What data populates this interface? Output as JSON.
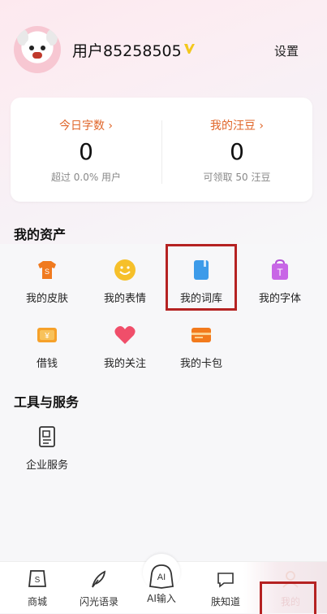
{
  "header": {
    "username": "用户85258505",
    "settings_label": "设置"
  },
  "stats": {
    "left": {
      "title": "今日字数 ›",
      "value": "0",
      "sub": "超过 0.0% 用户"
    },
    "right": {
      "title": "我的汪豆 ›",
      "value": "0",
      "sub": "可领取 50 汪豆"
    }
  },
  "assets": {
    "title": "我的资产",
    "items": [
      {
        "label": "我的皮肤",
        "icon": "shirt-icon"
      },
      {
        "label": "我的表情",
        "icon": "smile-icon"
      },
      {
        "label": "我的词库",
        "icon": "book-icon"
      },
      {
        "label": "我的字体",
        "icon": "font-bag-icon"
      },
      {
        "label": "借钱",
        "icon": "yen-icon"
      },
      {
        "label": "我的关注",
        "icon": "heart-icon"
      },
      {
        "label": "我的卡包",
        "icon": "wallet-icon"
      }
    ]
  },
  "tools": {
    "title": "工具与服务",
    "items": [
      {
        "label": "企业服务",
        "icon": "document-icon"
      }
    ]
  },
  "nav": {
    "items": [
      {
        "label": "商城",
        "icon": "store-icon"
      },
      {
        "label": "闪光语录",
        "icon": "feather-icon"
      },
      {
        "label": "AI输入",
        "icon": "ai-icon"
      },
      {
        "label": "肤知道",
        "icon": "chat-icon"
      },
      {
        "label": "我的",
        "icon": "profile-icon"
      }
    ]
  },
  "colors": {
    "accent_orange": "#e0662a",
    "highlight_red": "#b52222"
  }
}
